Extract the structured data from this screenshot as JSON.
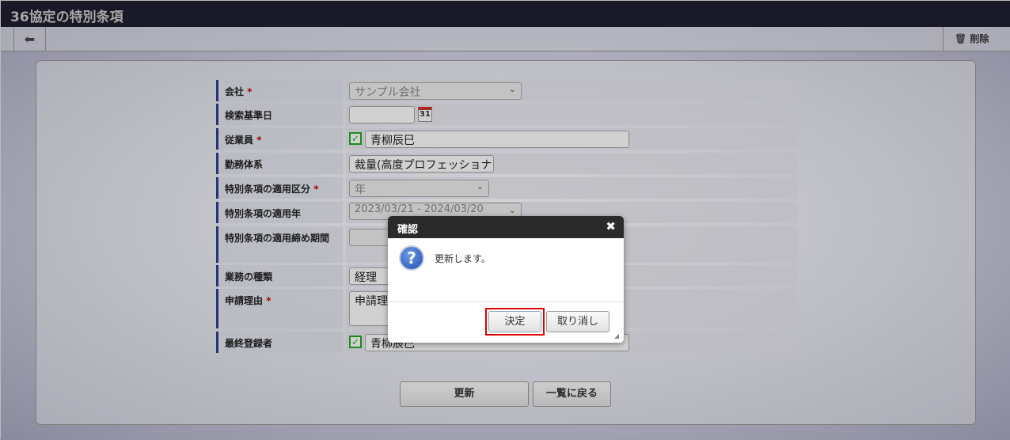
{
  "title": "36協定の特別条項",
  "toolbar": {
    "delete_label": "削除"
  },
  "form": {
    "company_label": "会社",
    "company_value": "サンプル会社",
    "date_label": "検索基準日",
    "calendar_day": "31",
    "employee_label": "従業員",
    "employee_value": "青柳辰巳",
    "worktype_label": "勤務体系",
    "worktype_value": "裁量(高度プロフェッショナ",
    "category_label": "特別条項の適用区分",
    "category_value": "年",
    "year_label": "特別条項の適用年",
    "year_value": "2023/03/21 - 2024/03/20",
    "period_label": "特別条項の適用締め期間",
    "business_label": "業務の種類",
    "business_value": "経理",
    "reason_label": "申請理由",
    "reason_value": "申請理由",
    "registrant_label": "最終登録者",
    "registrant_value": "青柳辰巳",
    "required_mark": "*"
  },
  "buttons": {
    "update": "更新",
    "back_to_list": "一覧に戻る"
  },
  "dialog": {
    "title": "確認",
    "message": "更新します。",
    "ok": "決定",
    "cancel": "取り消し"
  },
  "colors": {
    "highlight": "#e00000"
  }
}
